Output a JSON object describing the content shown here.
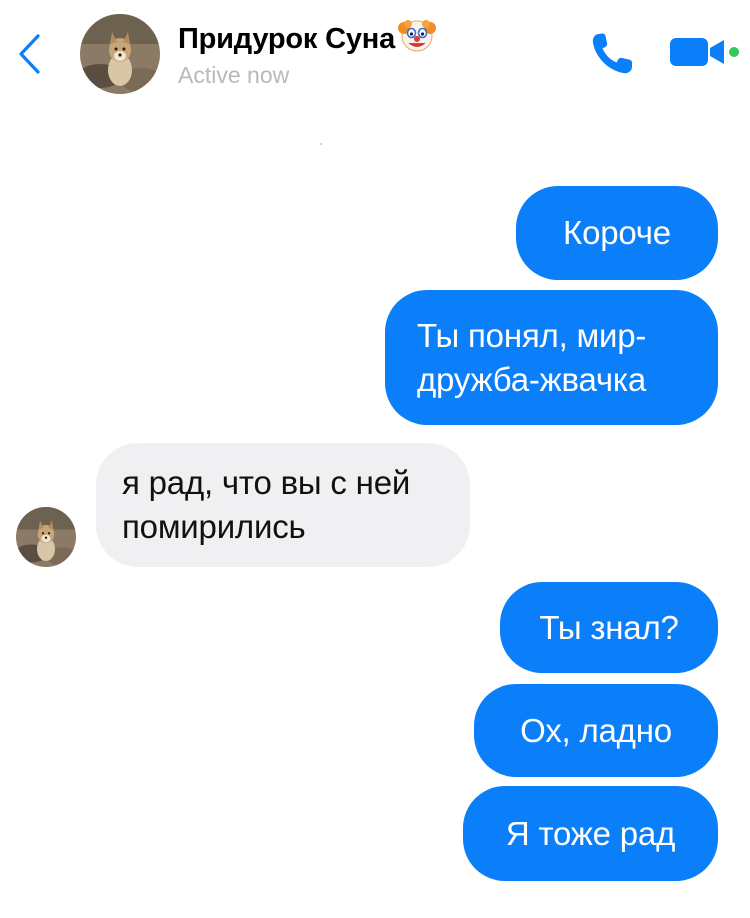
{
  "header": {
    "contact_name": "Придурок Суна",
    "status": "Active now",
    "accent_color": "#0b7ff9",
    "online_color": "#34c759",
    "icons": [
      "chevron-left-icon",
      "clown-face-icon",
      "phone-icon",
      "video-camera-icon"
    ]
  },
  "messages": [
    {
      "direction": "outgoing",
      "text": "Короче"
    },
    {
      "direction": "outgoing",
      "text": "Ты понял, мир-дружба-жвачка"
    },
    {
      "direction": "incoming",
      "text": "я рад, что вы с ней помирились"
    },
    {
      "direction": "outgoing",
      "text": "Ты знал?"
    },
    {
      "direction": "outgoing",
      "text": "Ох, ладно"
    },
    {
      "direction": "outgoing",
      "text": "Я тоже рад"
    }
  ],
  "colors": {
    "outgoing_bubble": "#0b7ff9",
    "incoming_bubble": "#f0f0f3",
    "status_text": "#b9b9bd"
  }
}
